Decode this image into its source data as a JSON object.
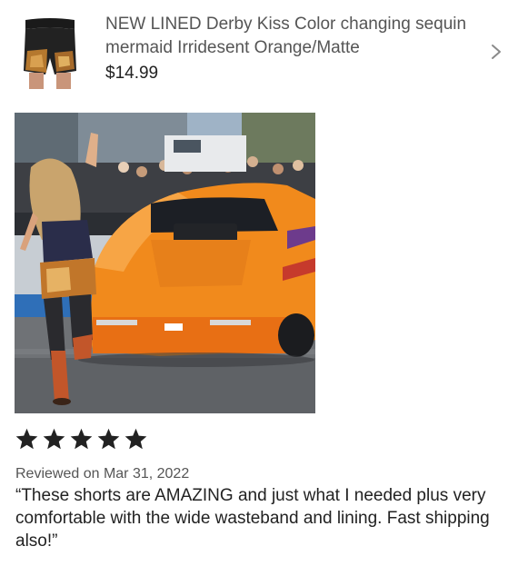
{
  "product": {
    "title": "NEW LINED Derby Kiss Color changing sequin mermaid Irridesent Orange/Matte",
    "price": "$14.99",
    "thumbnail_icon": "shorts-thumbnail",
    "chevron_icon": "chevron-right-icon"
  },
  "review": {
    "rating": 5,
    "rating_max": 5,
    "date": "Reviewed on Mar 31, 2022",
    "text": "“These shorts are AMAZING and just what I needed plus very comfortable with the wide wasteband and lining. Fast shipping also!”",
    "photo_icon": "review-photo"
  },
  "colors": {
    "text_primary": "#222222",
    "text_secondary": "#555555",
    "star": "#222222",
    "car_orange": "#F18A1C"
  }
}
